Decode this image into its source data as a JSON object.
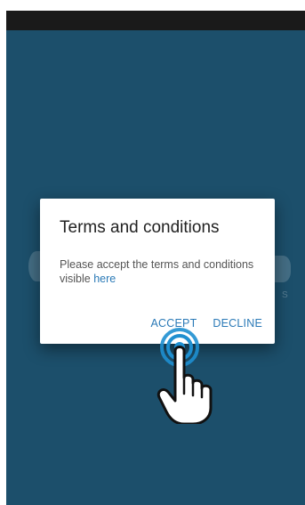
{
  "dialog": {
    "title": "Terms and conditions",
    "message": "Please accept the terms and conditions visible",
    "link_text": "here",
    "accept_label": "ACCEPT",
    "decline_label": "DECLINE"
  },
  "background": {
    "logo_suffix": "S"
  },
  "colors": {
    "app_background": "#1c4f6b",
    "status_bar": "#1a1a1a",
    "accent": "#2b7ab7",
    "tap_ring": "#1e8fd0"
  },
  "icons": {
    "tap_indicator": "tap-hand-icon"
  }
}
